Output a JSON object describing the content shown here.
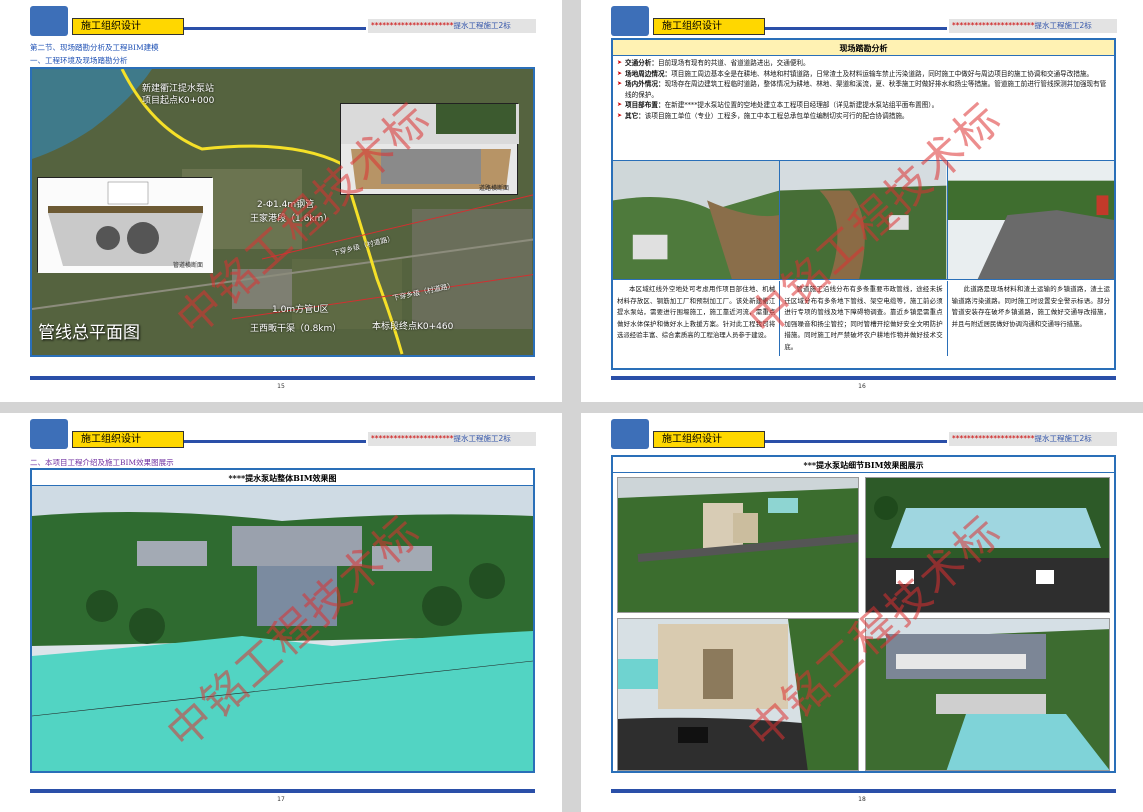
{
  "header": {
    "tag": "施工组织设计",
    "project_stars": "**********************",
    "project_name": "提水工程施工2标"
  },
  "page15": {
    "section_title": "第二节、现场踏勘分析及工程BIM建模",
    "subsection": "一、工程环境及现场踏勘分析",
    "map": {
      "labels": {
        "start_name": "新建衢江提水泵站",
        "start_km": "项目起点K0+000",
        "pipe_label": "2-Φ1.4m钢管",
        "pipe_segment": "王家港段（1.6km）",
        "pipe_label2": "1.0m方管U区",
        "pipe_segment2": "王西畈干渠（0.8km）",
        "end_point": "本标段终点K0+460",
        "road1": "下穿乡级（村道路）",
        "road2": "下穿乡级（村道路）",
        "inset_left_caption": "管道横断面",
        "inset_right_caption": "道路横断面"
      },
      "title": "管线总平面图"
    },
    "page_number": "15"
  },
  "page16": {
    "table_title": "现场踏勘分析",
    "bullets": [
      {
        "head": "交通分析：",
        "text": "目前现场有现有的共道、省道道路进出，交通便利。"
      },
      {
        "head": "场地周边情况：",
        "text": "项目施工周边基本全是在耕地、林地和村镇道路，日常渣土及材料运输车禁止污染道路，同时施工中做好与周边项目的施工协调和交通导改措施。"
      },
      {
        "head": "场内外情况：",
        "text": "现场存在周边建筑工程临时道路，整体情况为耕地、林地、渠道和溪流，夏、秋季施工时做好排水和扬尘等措施。管道施工前进行管线探测并加强现有管线的保护。"
      },
      {
        "head": "项目部布置：",
        "text": "在新建****提水泵站位置的空地处建立本工程项目经理部（详见新建提水泵站组平面布置图）。"
      },
      {
        "head": "其它：",
        "text": "该项目施工单位（专业）工程多，施工中本工程总承包单位编制切实可行的配合协调措施。"
      }
    ],
    "captions": [
      "本区域红线外空地处可考虑用作项目部住地、机械材料存放区、钢筋加工厂和预制加工厂。该处新建衢江提水泵站，需要进行围堰施工，施工靠近河流，需重点做好水体保护和做好水上救援方案。针对此工程我司将选派经验丰富、综合素质高的工程治理人员参于建设。",
      "管道施工沿线分布有多条重要市政管线，途经未拆迁区域分布有多条地下管线、架空电缆等，施工前必须进行专项的管线及地下障碍物调查。靠近乡镇是需重点加强噪音和扬尘管控；同时管槽开挖做好安全文明防护措施。同时施工时严禁破坏农户耕地作物并做好技术交底。",
      "此道路是现场材料和渣土运输的乡镇道路，渣土运输道路污染道路。同时施工时设置安全警示标语。部分管道安装存在破坏乡镇道路，施工做好交通导改措施，并且与附近居民做好协调沟通和交通导行措施。"
    ],
    "page_number": "16"
  },
  "page17": {
    "subsection": "二、本项目工程介绍及施工BIM效果图展示",
    "table_title": "****提水泵站整体BIM效果图",
    "page_number": "17"
  },
  "page18": {
    "table_title": "***提水泵站细节BIM效果图展示",
    "page_number": "18"
  },
  "watermark": "中铭工程技术标",
  "colors": {
    "accent_blue": "#2a4fa8",
    "header_yellow": "#ffd700",
    "watermark_red": "#dc3232",
    "table_head_yellow": "#fff2b3"
  }
}
